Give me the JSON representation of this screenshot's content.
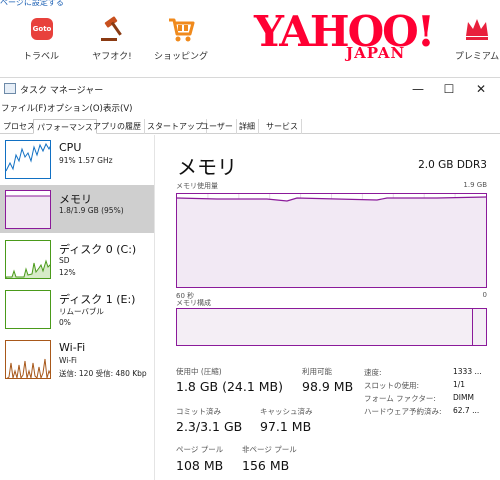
{
  "yahoo": {
    "set_home": "ページに設定する",
    "services": [
      {
        "label": "トラベル",
        "icon": "travel-icon",
        "badge": "Goto"
      },
      {
        "label": "ヤフオク!",
        "icon": "auction-gavel-icon"
      },
      {
        "label": "ショッピング",
        "icon": "shopping-cart-icon"
      },
      {
        "label": "プレミアム",
        "icon": "premium-crown-icon"
      }
    ],
    "logo": "YAHOO!",
    "logo_sub": "JAPAN",
    "brand_color": "#ff0033"
  },
  "window": {
    "title": "タスク マネージャー",
    "buttons": {
      "minimize": "—",
      "maximize": "☐",
      "close": "✕"
    }
  },
  "menu": [
    "ファイル(F)",
    "オプション(O)",
    "表示(V)"
  ],
  "tabs": [
    {
      "label": "プロセス",
      "active": false
    },
    {
      "label": "パフォーマンス",
      "active": true
    },
    {
      "label": "アプリの履歴",
      "active": false
    },
    {
      "label": "スタートアップ",
      "active": false
    },
    {
      "label": "ユーザー",
      "active": false
    },
    {
      "label": "詳細",
      "active": false
    },
    {
      "label": "サービス",
      "active": false
    }
  ],
  "sidebar": [
    {
      "name": "CPU",
      "sub1": "91%  1.57 GHz",
      "sub2": "",
      "color": "#1170c3"
    },
    {
      "name": "メモリ",
      "sub1": "1.8/1.9 GB (95%)",
      "sub2": "",
      "color": "#8b1a9a"
    },
    {
      "name": "ディスク 0 (C:)",
      "sub1": "SD",
      "sub2": "12%",
      "color": "#4a9a1a"
    },
    {
      "name": "ディスク 1 (E:)",
      "sub1": "リムーバブル",
      "sub2": "0%",
      "color": "#4a9a1a"
    },
    {
      "name": "Wi-Fi",
      "sub1": "Wi-Fi",
      "sub2": "送信: 120 受信: 480 Kbp",
      "color": "#a8581a"
    }
  ],
  "memory": {
    "title": "メモリ",
    "capacity": "2.0 GB DDR3",
    "usage_label": "メモリ使用量",
    "usage_max": "1.9 GB",
    "time_left": "60 秒",
    "time_right": "0",
    "composition_label": "メモリ構成",
    "stats": {
      "in_use_label": "使用中 (圧縮)",
      "in_use": "1.8 GB (24.1 MB)",
      "available_label": "利用可能",
      "available": "98.9 MB",
      "committed_label": "コミット済み",
      "committed": "2.3/3.1 GB",
      "cached_label": "キャッシュ済み",
      "cached": "97.1 MB",
      "paged_label": "ページ プール",
      "paged": "108 MB",
      "nonpaged_label": "非ページ プール",
      "nonpaged": "156 MB"
    },
    "details": [
      {
        "label": "速度:",
        "value": "1333 ..."
      },
      {
        "label": "スロットの使用:",
        "value": "1/1"
      },
      {
        "label": "フォーム ファクター:",
        "value": "DIMM"
      },
      {
        "label": "ハードウェア予約済み:",
        "value": "62.7 ..."
      }
    ],
    "usage_fraction": 0.95,
    "accent": "#8b1a9a"
  }
}
